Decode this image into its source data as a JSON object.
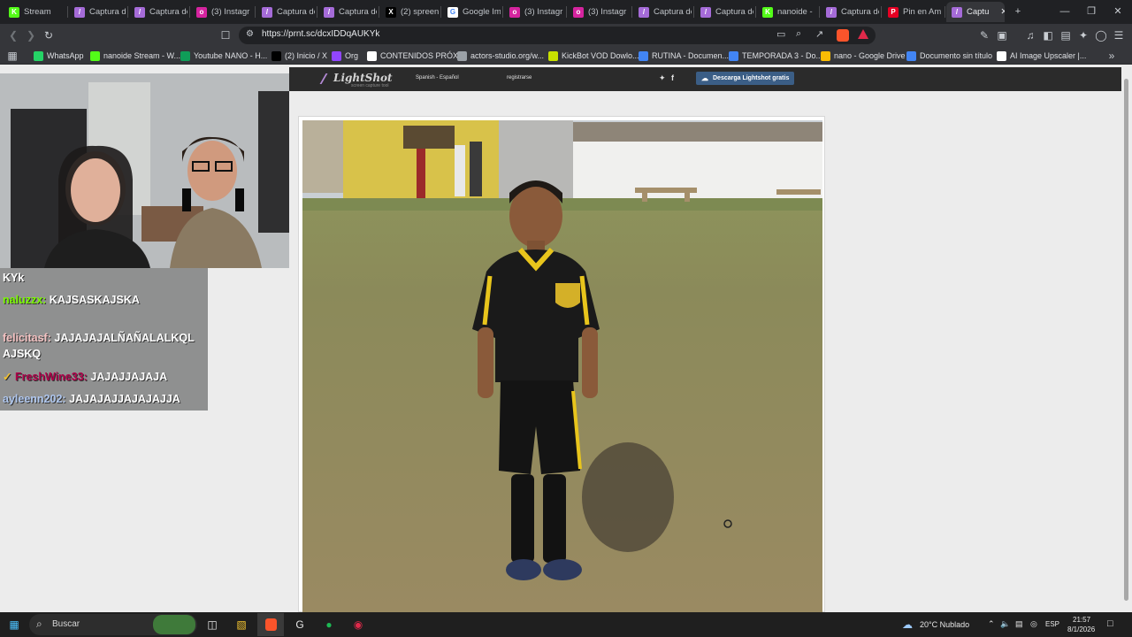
{
  "tabs": [
    {
      "title": "Stream",
      "icon": "kick-icon",
      "color": "#53fc18"
    },
    {
      "title": "Captura de",
      "icon": "feather-icon",
      "color": "#a56bd8"
    },
    {
      "title": "Captura de",
      "icon": "feather-icon",
      "color": "#a56bd8"
    },
    {
      "title": "(3) Instagr",
      "icon": "instagram-icon",
      "color": "#d6249f"
    },
    {
      "title": "Captura de",
      "icon": "feather-icon",
      "color": "#a56bd8"
    },
    {
      "title": "Captura de",
      "icon": "feather-icon",
      "color": "#a56bd8"
    },
    {
      "title": "(2) spreen",
      "icon": "x-icon",
      "color": "#000000"
    },
    {
      "title": "Google Im",
      "icon": "google-icon",
      "color": "#ffffff"
    },
    {
      "title": "(3) Instagr",
      "icon": "instagram-icon",
      "color": "#d6249f"
    },
    {
      "title": "(3) Instagr",
      "icon": "instagram-icon",
      "color": "#d6249f"
    },
    {
      "title": "Captura de",
      "icon": "feather-icon",
      "color": "#a56bd8"
    },
    {
      "title": "Captura de",
      "icon": "feather-icon",
      "color": "#a56bd8"
    },
    {
      "title": "nanoide -",
      "icon": "kick-icon",
      "color": "#53fc18"
    },
    {
      "title": "Captura de",
      "icon": "feather-icon",
      "color": "#a56bd8"
    },
    {
      "title": "Pin en Am",
      "icon": "pinterest-icon",
      "color": "#e60023"
    },
    {
      "title": "Captu",
      "icon": "feather-icon",
      "color": "#a56bd8",
      "active": true
    }
  ],
  "toolbar": {
    "url": "https://prnt.sc/dcxIDDqAUKYk"
  },
  "bookmarks": [
    {
      "label": "WhatsApp",
      "icon": "whatsapp-icon",
      "color": "#25d366"
    },
    {
      "label": "nanoide Stream - W...",
      "icon": "kick-icon",
      "color": "#53fc18"
    },
    {
      "label": "Youtube NANO - H...",
      "icon": "sheets-icon",
      "color": "#0f9d58"
    },
    {
      "label": "(2) Inicio / X",
      "icon": "x-icon",
      "color": "#000000"
    },
    {
      "label": "Org",
      "icon": "twitch-icon",
      "color": "#9146ff"
    },
    {
      "label": "CONTENIDOS PRÓX...",
      "icon": "docs-icon",
      "color": "#ffffff"
    },
    {
      "label": "actors-studio.org/w...",
      "icon": "globe-icon",
      "color": "#9aa0a6"
    },
    {
      "label": "KickBot VOD Dowlo...",
      "icon": "kickbot-icon",
      "color": "#c8e000"
    },
    {
      "label": "RUTINA - Documen...",
      "icon": "docs-icon",
      "color": "#4285f4"
    },
    {
      "label": "TEMPORADA 3 - Do...",
      "icon": "docs-icon",
      "color": "#4285f4"
    },
    {
      "label": "nano - Google Drive",
      "icon": "drive-icon",
      "color": "#fbbc04"
    },
    {
      "label": "Documento sin título",
      "icon": "docs-icon",
      "color": "#4285f4"
    },
    {
      "label": "AI Image Upscaler |...",
      "icon": "ai-icon",
      "color": "#ffffff"
    }
  ],
  "lightshot": {
    "logo": "LightShot",
    "tagline": "screen capture tool",
    "language": "Spanish - Español",
    "register": "registrarse",
    "download": "Descarga Lightshot gratis"
  },
  "chat": [
    {
      "user": "",
      "message": "KYk",
      "color": "#ffffff"
    },
    {
      "user": "naluzzx:",
      "message": "KAJSASKAJSKA",
      "color": "#7cfc00"
    },
    {
      "user": "felicitasf:",
      "message": "JAJAJAJALÑAÑALALKQL",
      "color": "#f4c2c2"
    },
    {
      "user": "",
      "message": "AJSKQ",
      "color": "#ffffff"
    },
    {
      "user": "FreshWine33:",
      "message": "JAJAJJAJAJA",
      "color": "#b0004a"
    },
    {
      "user": "ayleenn202:",
      "message": "JAJAJAJJAJAJAJJA",
      "color": "#b0c8f0"
    }
  ],
  "taskbar": {
    "search_placeholder": "Buscar",
    "weather": "20°C  Nublado",
    "language": "ESP",
    "time": "21:57",
    "date": "8/1/2026"
  }
}
